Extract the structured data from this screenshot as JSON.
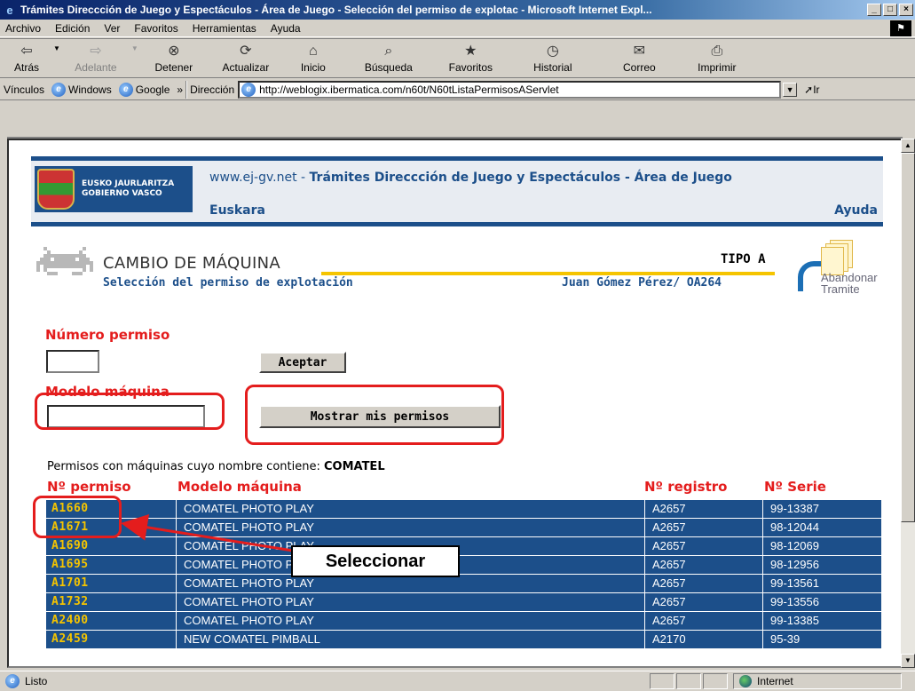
{
  "window": {
    "title": "Trámites Direccción de Juego y Espectáculos - Área de Juego - Selección del permiso de explotac - Microsoft Internet Expl..."
  },
  "menu": [
    "Archivo",
    "Edición",
    "Ver",
    "Favoritos",
    "Herramientas",
    "Ayuda"
  ],
  "toolbar": {
    "back": "Atrás",
    "forward": "Adelante",
    "stop": "Detener",
    "refresh": "Actualizar",
    "home": "Inicio",
    "search": "Búsqueda",
    "favorites": "Favoritos",
    "history": "Historial",
    "mail": "Correo",
    "print": "Imprimir"
  },
  "address_bar": {
    "links_label": "Vínculos",
    "link1": "Windows",
    "link2": "Google",
    "chevron": "»",
    "address_label": "Dirección",
    "url": "http://weblogix.ibermatica.com/n60t/N60tListaPermisosAServlet",
    "go_label": "Ir"
  },
  "header": {
    "logo_line1": "EUSKO JAURLARITZA",
    "logo_line2": "GOBIERNO VASCO",
    "site_prefix": "www.ej-gv.net - ",
    "site_title": "Trámites Direccción de Juego y Espectáculos - Área de Juego",
    "euskara": "Euskara",
    "ayuda": "Ayuda"
  },
  "title": {
    "main": "CAMBIO DE MÁQUINA",
    "subtitle": "Selección del permiso de explotación",
    "tipo": "TIPO A",
    "user": "Juan Gómez Pérez/ OA264",
    "abandonar_1": "Abandonar",
    "abandonar_2": "Tramite"
  },
  "form": {
    "numero_label": "Número permiso",
    "numero_value": "",
    "aceptar": "Aceptar",
    "modelo_label": "Modelo máquina",
    "modelo_value": "",
    "mostrar": "Mostrar mis permisos"
  },
  "results": {
    "intro": "Permisos con máquinas cuyo nombre contiene: ",
    "term": "COMATEL",
    "headers": [
      "Nº permiso",
      "Modelo máquina",
      "Nº registro",
      "Nº Serie"
    ],
    "rows": [
      [
        "A1660",
        "COMATEL PHOTO PLAY",
        "A2657",
        "99-13387"
      ],
      [
        "A1671",
        "COMATEL PHOTO PLAY",
        "A2657",
        "98-12044"
      ],
      [
        "A1690",
        "COMATEL PHOTO PLAY",
        "A2657",
        "98-12069"
      ],
      [
        "A1695",
        "COMATEL PHOTO PLAY",
        "A2657",
        "98-12956"
      ],
      [
        "A1701",
        "COMATEL PHOTO PLAY",
        "A2657",
        "99-13561"
      ],
      [
        "A1732",
        "COMATEL PHOTO PLAY",
        "A2657",
        "99-13556"
      ],
      [
        "A2400",
        "COMATEL PHOTO PLAY",
        "A2657",
        "99-13385"
      ],
      [
        "A2459",
        "NEW COMATEL PIMBALL",
        "A2170",
        "95-39"
      ]
    ]
  },
  "annotation": {
    "callout": "Seleccionar"
  },
  "status": {
    "text": "Listo",
    "zone": "Internet"
  },
  "colors": {
    "brand_blue": "#1c4f8a",
    "accent_red": "#e41d1d",
    "accent_yellow": "#f5c400"
  }
}
